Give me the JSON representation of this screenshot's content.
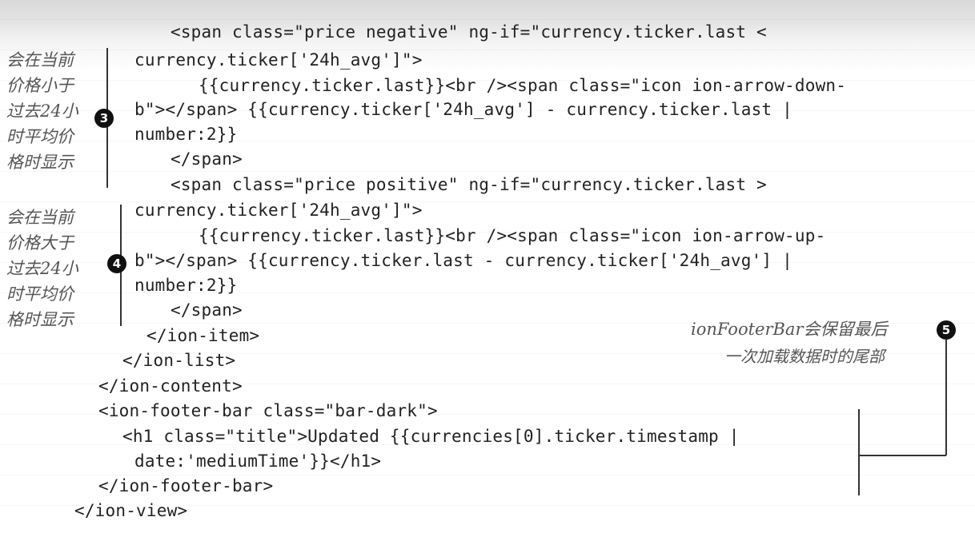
{
  "code_lines": [
    "<span class=\"price negative\" ng-if=\"currency.ticker.last <",
    "currency.ticker['24h_avg']\">",
    "{{currency.ticker.last}}<br /><span class=\"icon ion-arrow-down-",
    "b\"></span> {{currency.ticker['24h_avg'] - currency.ticker.last |",
    "number:2}}",
    "</span>",
    "<span class=\"price positive\" ng-if=\"currency.ticker.last >",
    "currency.ticker['24h_avg']\">",
    "{{currency.ticker.last}}<br /><span class=\"icon ion-arrow-up-",
    "b\"></span> {{currency.ticker.last - currency.ticker['24h_avg'] |",
    "number:2}}",
    "</span>",
    "</ion-item>",
    "</ion-list>",
    "</ion-content>",
    "<ion-footer-bar class=\"bar-dark\">",
    "<h1 class=\"title\">Updated {{currencies[0].ticker.timestamp |",
    "date:'mediumTime'}}</h1>",
    "</ion-footer-bar>",
    "</ion-view>"
  ],
  "annotations": {
    "note3": {
      "marker": "3",
      "lines": [
        "会在当前",
        "价格小于",
        "过去24小",
        "时平均价",
        "格时显示"
      ]
    },
    "note4": {
      "marker": "4",
      "lines": [
        "会在当前",
        "价格大于",
        "过去24小",
        "时平均价",
        "格时显示"
      ]
    },
    "note5": {
      "marker": "5",
      "lines": [
        "ionFooterBar会保留最后",
        "一次加载数据时的尾部"
      ]
    }
  }
}
